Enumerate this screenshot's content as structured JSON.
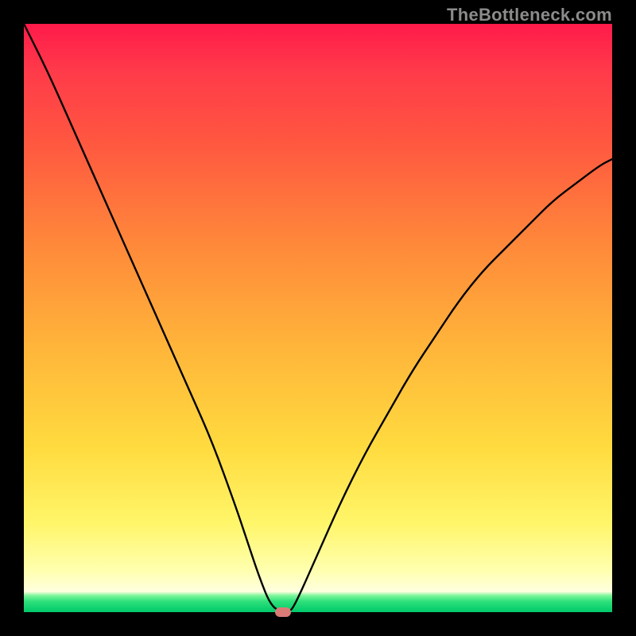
{
  "watermark": "TheBottleneck.com",
  "chart_data": {
    "type": "line",
    "title": "",
    "xlabel": "",
    "ylabel": "",
    "xlim": [
      0,
      100
    ],
    "ylim": [
      0,
      100
    ],
    "grid": false,
    "legend": false,
    "annotations": [],
    "gradient_stops": [
      {
        "pos": 0.0,
        "color": "#ff1a4a"
      },
      {
        "pos": 0.2,
        "color": "#ff5740"
      },
      {
        "pos": 0.55,
        "color": "#ffb53a"
      },
      {
        "pos": 0.85,
        "color": "#fff66a"
      },
      {
        "pos": 0.965,
        "color": "#ffffe0"
      },
      {
        "pos": 0.98,
        "color": "#2de07a"
      },
      {
        "pos": 1.0,
        "color": "#00c86a"
      }
    ],
    "series": [
      {
        "name": "bottleneck-curve",
        "x": [
          0,
          4,
          8,
          12,
          16,
          20,
          24,
          28,
          32,
          36,
          38,
          40,
          42,
          44,
          45,
          46,
          50,
          54,
          58,
          62,
          66,
          70,
          74,
          78,
          82,
          86,
          90,
          94,
          98,
          100
        ],
        "y": [
          100,
          92,
          83,
          74,
          65,
          56,
          47,
          38,
          29,
          18,
          12,
          6,
          1,
          0,
          0,
          1,
          10,
          19,
          27,
          34,
          41,
          47,
          53,
          58,
          62,
          66,
          70,
          73,
          76,
          77
        ]
      }
    ],
    "marker": {
      "x": 44,
      "y": 0,
      "color": "#da7a77"
    }
  }
}
